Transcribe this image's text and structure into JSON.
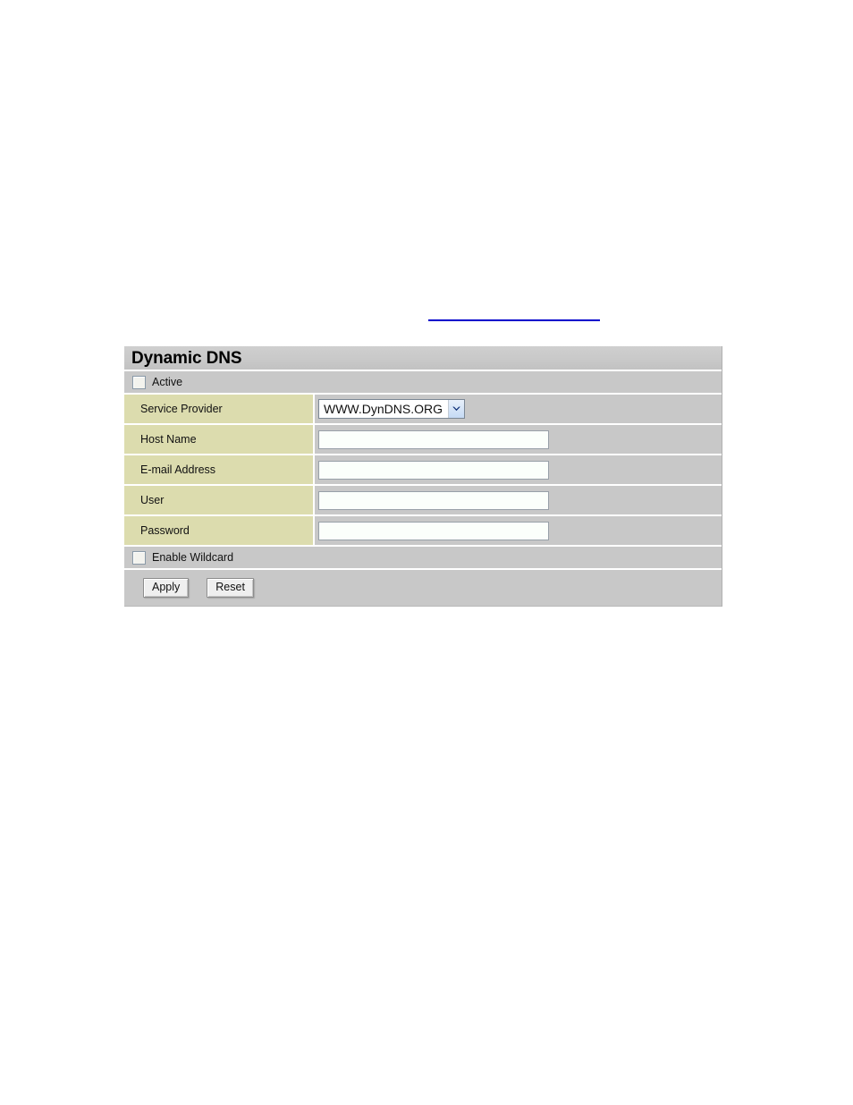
{
  "page": {
    "background_color": "#ffffff",
    "rule_color": "#0000cc"
  },
  "panel": {
    "title": "Dynamic DNS",
    "header_bg": "#c9c9c9",
    "row_bg": "#c8c8c8",
    "label_bg": "#dcdcae",
    "active": {
      "label": "Active",
      "checked": false
    },
    "fields": [
      {
        "label": "Service Provider",
        "type": "select",
        "value": "WWW.DynDNS.ORG",
        "options": [
          "WWW.DynDNS.ORG"
        ]
      },
      {
        "label": "Host Name",
        "type": "text",
        "value": "",
        "placeholder": ""
      },
      {
        "label": "E-mail Address",
        "type": "text",
        "value": "",
        "placeholder": ""
      },
      {
        "label": "User",
        "type": "text",
        "value": "",
        "placeholder": ""
      },
      {
        "label": "Password",
        "type": "password",
        "value": "",
        "placeholder": ""
      }
    ],
    "wildcard": {
      "label": "Enable Wildcard",
      "checked": false
    },
    "buttons": {
      "apply_label": "Apply",
      "reset_label": "Reset"
    }
  }
}
